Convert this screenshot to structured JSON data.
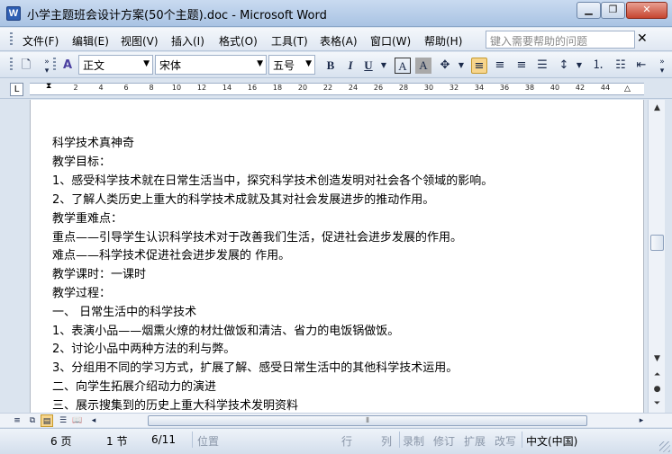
{
  "window": {
    "title": "小学主题班会设计方案(50个主题).doc - Microsoft Word",
    "app_icon_label": "W"
  },
  "menu": {
    "items": [
      {
        "id": "file",
        "label": "文件(F)"
      },
      {
        "id": "edit",
        "label": "编辑(E)"
      },
      {
        "id": "view",
        "label": "视图(V)"
      },
      {
        "id": "insert",
        "label": "插入(I)"
      },
      {
        "id": "format",
        "label": "格式(O)"
      },
      {
        "id": "tools",
        "label": "工具(T)"
      },
      {
        "id": "table",
        "label": "表格(A)"
      },
      {
        "id": "window",
        "label": "窗口(W)"
      },
      {
        "id": "help",
        "label": "帮助(H)"
      }
    ],
    "help_placeholder": "键入需要帮助的问题"
  },
  "toolbar": {
    "style": "正文",
    "font": "宋体",
    "size": "五号",
    "bold_label": "B",
    "italic_label": "I",
    "underline_label": "U",
    "char_border_label": "A",
    "char_shading_label": "A"
  },
  "ruler": {
    "ticks": [
      "2",
      "4",
      "6",
      "8",
      "10",
      "12",
      "14",
      "16",
      "18",
      "20",
      "22",
      "24",
      "26",
      "28",
      "30",
      "32",
      "34",
      "36",
      "38",
      "40",
      "42",
      "44"
    ]
  },
  "document": {
    "lines": [
      "科学技术真神奇",
      "教学目标：",
      "1、感受科学技术就在日常生活当中，探究科学技术创造发明对社会各个领域的影响。",
      "2、了解人类历史上重大的科学技术成就及其对社会发展进步的推动作用。",
      "教学重难点：",
      "重点——引导学生认识科学技术对于改善我们生活，促进社会进步发展的作用。",
      "难点——科学技术促进社会进步发展的 作用。",
      "教学课时：一课时",
      "教学过程：",
      "一、   日常生活中的科学技术",
      "1、表演小品——烟熏火燎的材灶做饭和清洁、省力的电饭锅做饭。",
      "2、讨论小品中两种方法的利与弊。",
      "3、分组用不同的学习方式，扩展了解、感受日常生活中的其他科学技术运用。",
      "二、向学生拓展介绍动力的演进",
      "三、展示搜集到的历史上重大科学技术发明资料"
    ]
  },
  "status": {
    "page": "6 页",
    "section": "1 节",
    "page_of": "6/11",
    "position": "位置",
    "line": "行",
    "column": "列",
    "record": "录制",
    "revision": "修订",
    "extend": "扩展",
    "overtype": "改写",
    "language": "中文(中国)"
  }
}
